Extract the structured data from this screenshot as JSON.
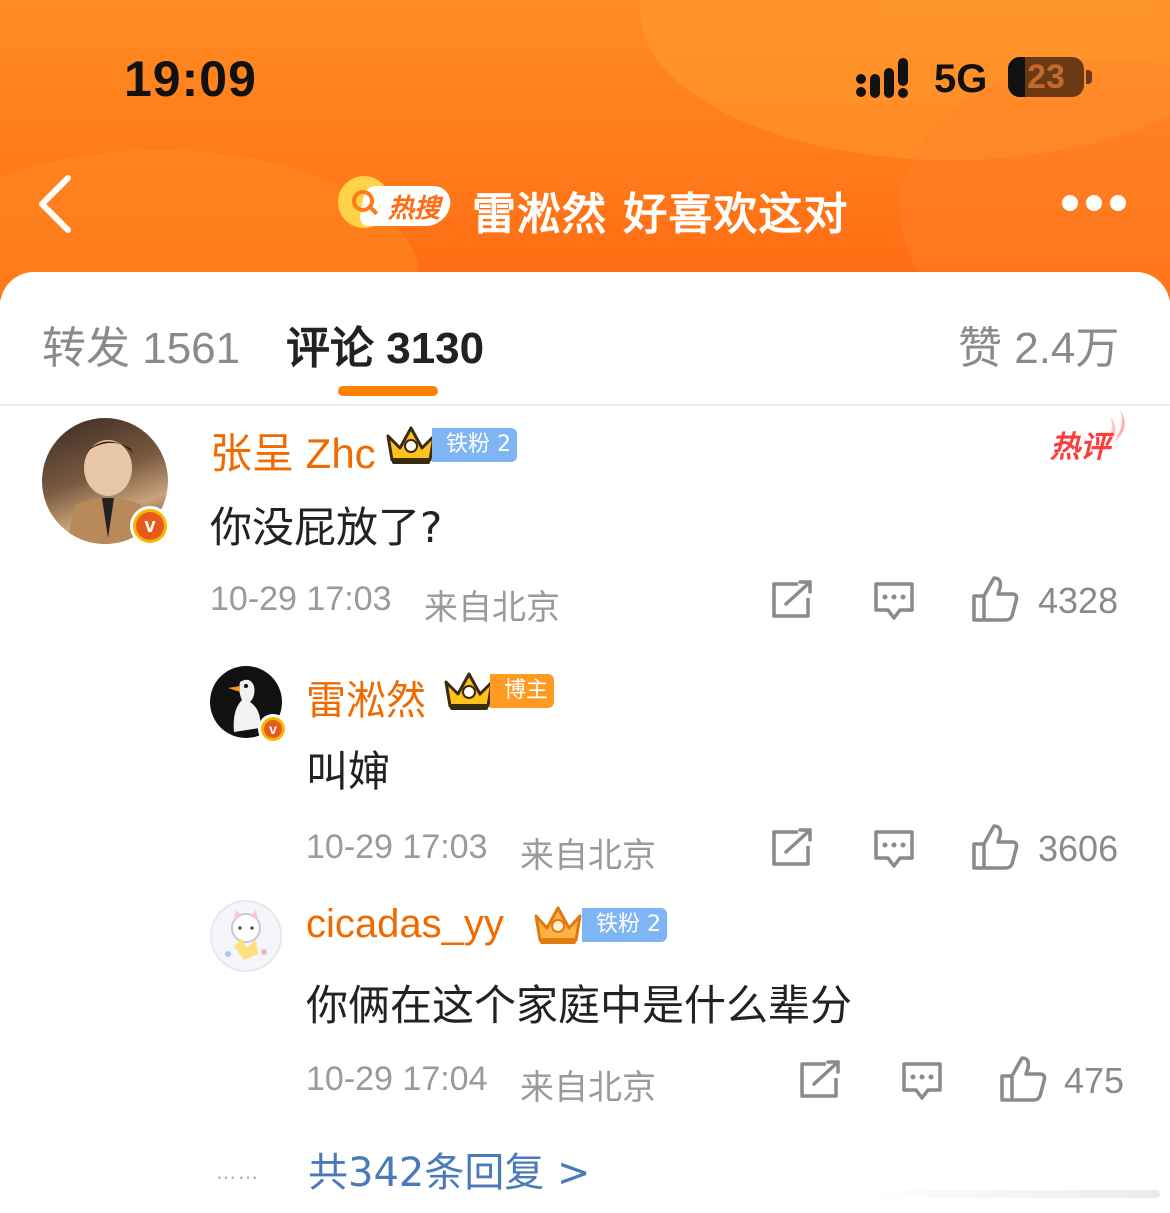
{
  "status_bar": {
    "time": "19:09",
    "network": "5G",
    "battery_level": "23",
    "battery_fraction": 0.23
  },
  "header": {
    "hot_search_label": "热搜",
    "topic": "雷淞然 好喜欢这对"
  },
  "tabs": {
    "repost": "转发 1561",
    "comments": "评论 3130",
    "likes": "赞 2.4万"
  },
  "hot_comment_badge": "热评",
  "comment": {
    "username": "张呈 Zhc",
    "fan_tag": "铁粉 2",
    "text": "你没屁放了?",
    "time": "10-29 17:03",
    "location": "来自北京",
    "likes": "4328"
  },
  "replies": [
    {
      "username": "雷淞然",
      "tag": "博主",
      "text": "叫婶",
      "time": "10-29 17:03",
      "location": "来自北京",
      "likes": "3606"
    },
    {
      "username": "cicadas_yy",
      "tag": "铁粉 2",
      "text": "你俩在这个家庭中是什么辈分",
      "time": "10-29 17:04",
      "location": "来自北京",
      "likes": "475"
    }
  ],
  "more_replies": "共342条回复 >",
  "icons": [
    "back-arrow-icon",
    "search-icon",
    "more-dots-icon",
    "share-icon",
    "comment-icon",
    "like-icon",
    "crown-icon",
    "verified-v-icon",
    "signal-icon",
    "battery-icon"
  ],
  "colors": {
    "header_orange": "#ff7a1a",
    "accent": "#ff8200",
    "username": "#f06a00",
    "link": "#4a7bb8",
    "fan_tag": "#7fb5f5",
    "host_tag": "#ff9a22",
    "hot_badge": "#ff3c3c"
  }
}
